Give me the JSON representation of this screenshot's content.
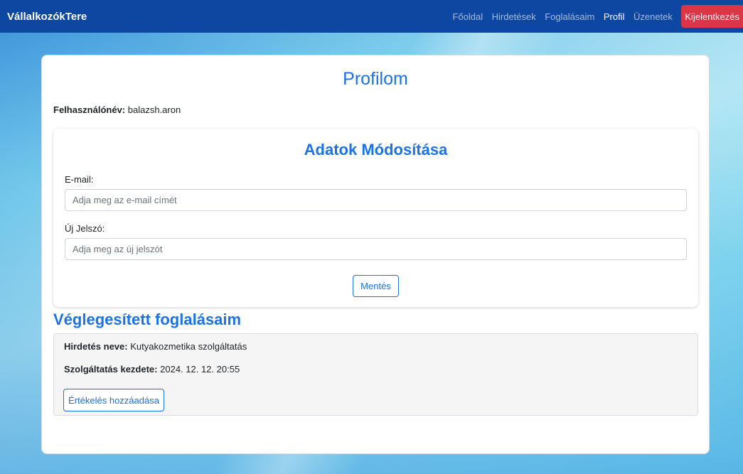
{
  "navbar": {
    "brand": "VállalkozókTere",
    "links": [
      "Főoldal",
      "Hirdetések",
      "Foglalásaim",
      "Profil",
      "Üzenetek"
    ],
    "logout_label": "Kijelentkezés"
  },
  "profile": {
    "title": "Profilom",
    "username_label": "Felhasználónév:",
    "username_value": "balazsh.aron"
  },
  "edit_form": {
    "title": "Adatok Módosítása",
    "email_label": "E-mail:",
    "email_placeholder": "Adja meg az e-mail címét",
    "password_label": "Új Jelszó:",
    "password_placeholder": "Adja meg az új jelszót",
    "save_label": "Mentés"
  },
  "bookings": {
    "title": "Véglegesített foglalásaim",
    "items": [
      {
        "ad_name_label": "Hirdetés neve:",
        "ad_name_value": "Kutyakozmetika szolgáltatás",
        "start_label": "Szolgáltatás kezdete:",
        "start_value": "2024. 12. 12. 20:55",
        "review_label": "Értékelés hozzáadása"
      }
    ]
  },
  "colors": {
    "navbar": "#0d47a1",
    "accent": "#1a73e8",
    "logout": "#dc3545"
  }
}
